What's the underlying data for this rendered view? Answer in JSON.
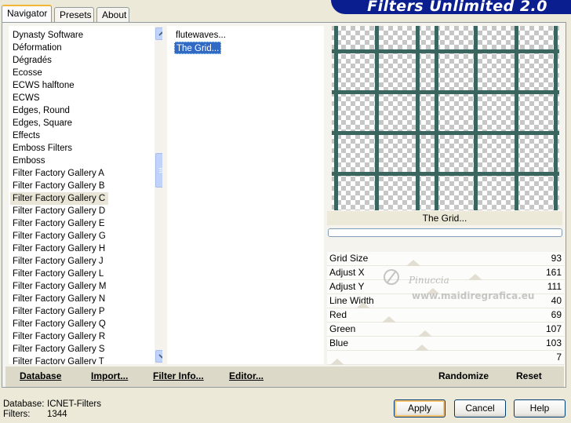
{
  "tabs": [
    {
      "label": "Navigator",
      "active": true
    },
    {
      "label": "Presets",
      "active": false
    },
    {
      "label": "About",
      "active": false
    }
  ],
  "banner": {
    "title": "Filters Unlimited 2.0"
  },
  "categories": {
    "items": [
      "Dynasty Software",
      "Déformation",
      "Dégradés",
      "Ecosse",
      "ECWS halftone",
      "ECWS",
      "Edges, Round",
      "Edges, Square",
      "Effects",
      "Emboss Filters",
      "Emboss",
      "Filter Factory Gallery A",
      "Filter Factory Gallery B",
      "Filter Factory Gallery C",
      "Filter Factory Gallery D",
      "Filter Factory Gallery E",
      "Filter Factory Gallery G",
      "Filter Factory Gallery H",
      "Filter Factory Gallery J",
      "Filter Factory Gallery L",
      "Filter Factory Gallery M",
      "Filter Factory Gallery N",
      "Filter Factory Gallery P",
      "Filter Factory Gallery Q",
      "Filter Factory Gallery R",
      "Filter Factory Gallery S",
      "Filter Factory Gallery T"
    ],
    "selected": "Filter Factory Gallery C"
  },
  "filters": {
    "items": [
      "flutewaves...",
      "The Grid..."
    ],
    "selected": "The Grid..."
  },
  "preview": {
    "name": "The Grid...",
    "grid_color": "#3b6660"
  },
  "params": [
    {
      "label": "Grid Size",
      "value": "93"
    },
    {
      "label": "Adjust X",
      "value": "161"
    },
    {
      "label": "Adjust Y",
      "value": "111"
    },
    {
      "label": "Line Width",
      "value": "40"
    },
    {
      "label": "Red",
      "value": "69"
    },
    {
      "label": "Green",
      "value": "107"
    },
    {
      "label": "Blue",
      "value": "103"
    },
    {
      "label": "",
      "value": "7"
    }
  ],
  "watermark": {
    "line1": "Pinuccia",
    "line2": "www.maidiregrafica.eu"
  },
  "bottom_bar": {
    "database": "Database",
    "import": "Import...",
    "filter_info": "Filter Info...",
    "editor": "Editor...",
    "randomize": "Randomize",
    "reset": "Reset"
  },
  "footer": {
    "database_label": "Database:",
    "database_value": "ICNET-Filters",
    "filters_label": "Filters:",
    "filters_value": "1344",
    "apply": "Apply",
    "cancel": "Cancel",
    "help": "Help"
  }
}
